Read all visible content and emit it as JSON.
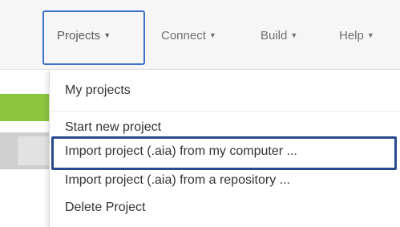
{
  "nav": {
    "projects": "Projects",
    "connect": "Connect",
    "build": "Build",
    "help": "Help",
    "caret": "▼"
  },
  "menu": {
    "items": [
      "My projects",
      "Start new project",
      "Import project (.aia) from my computer ...",
      "Import project (.aia) from a repository ...",
      "Delete Project"
    ]
  },
  "colors": {
    "highlight_projects": "#3f72c8",
    "highlight_import": "#2a4a8f",
    "green_bar": "#8cc63f"
  }
}
